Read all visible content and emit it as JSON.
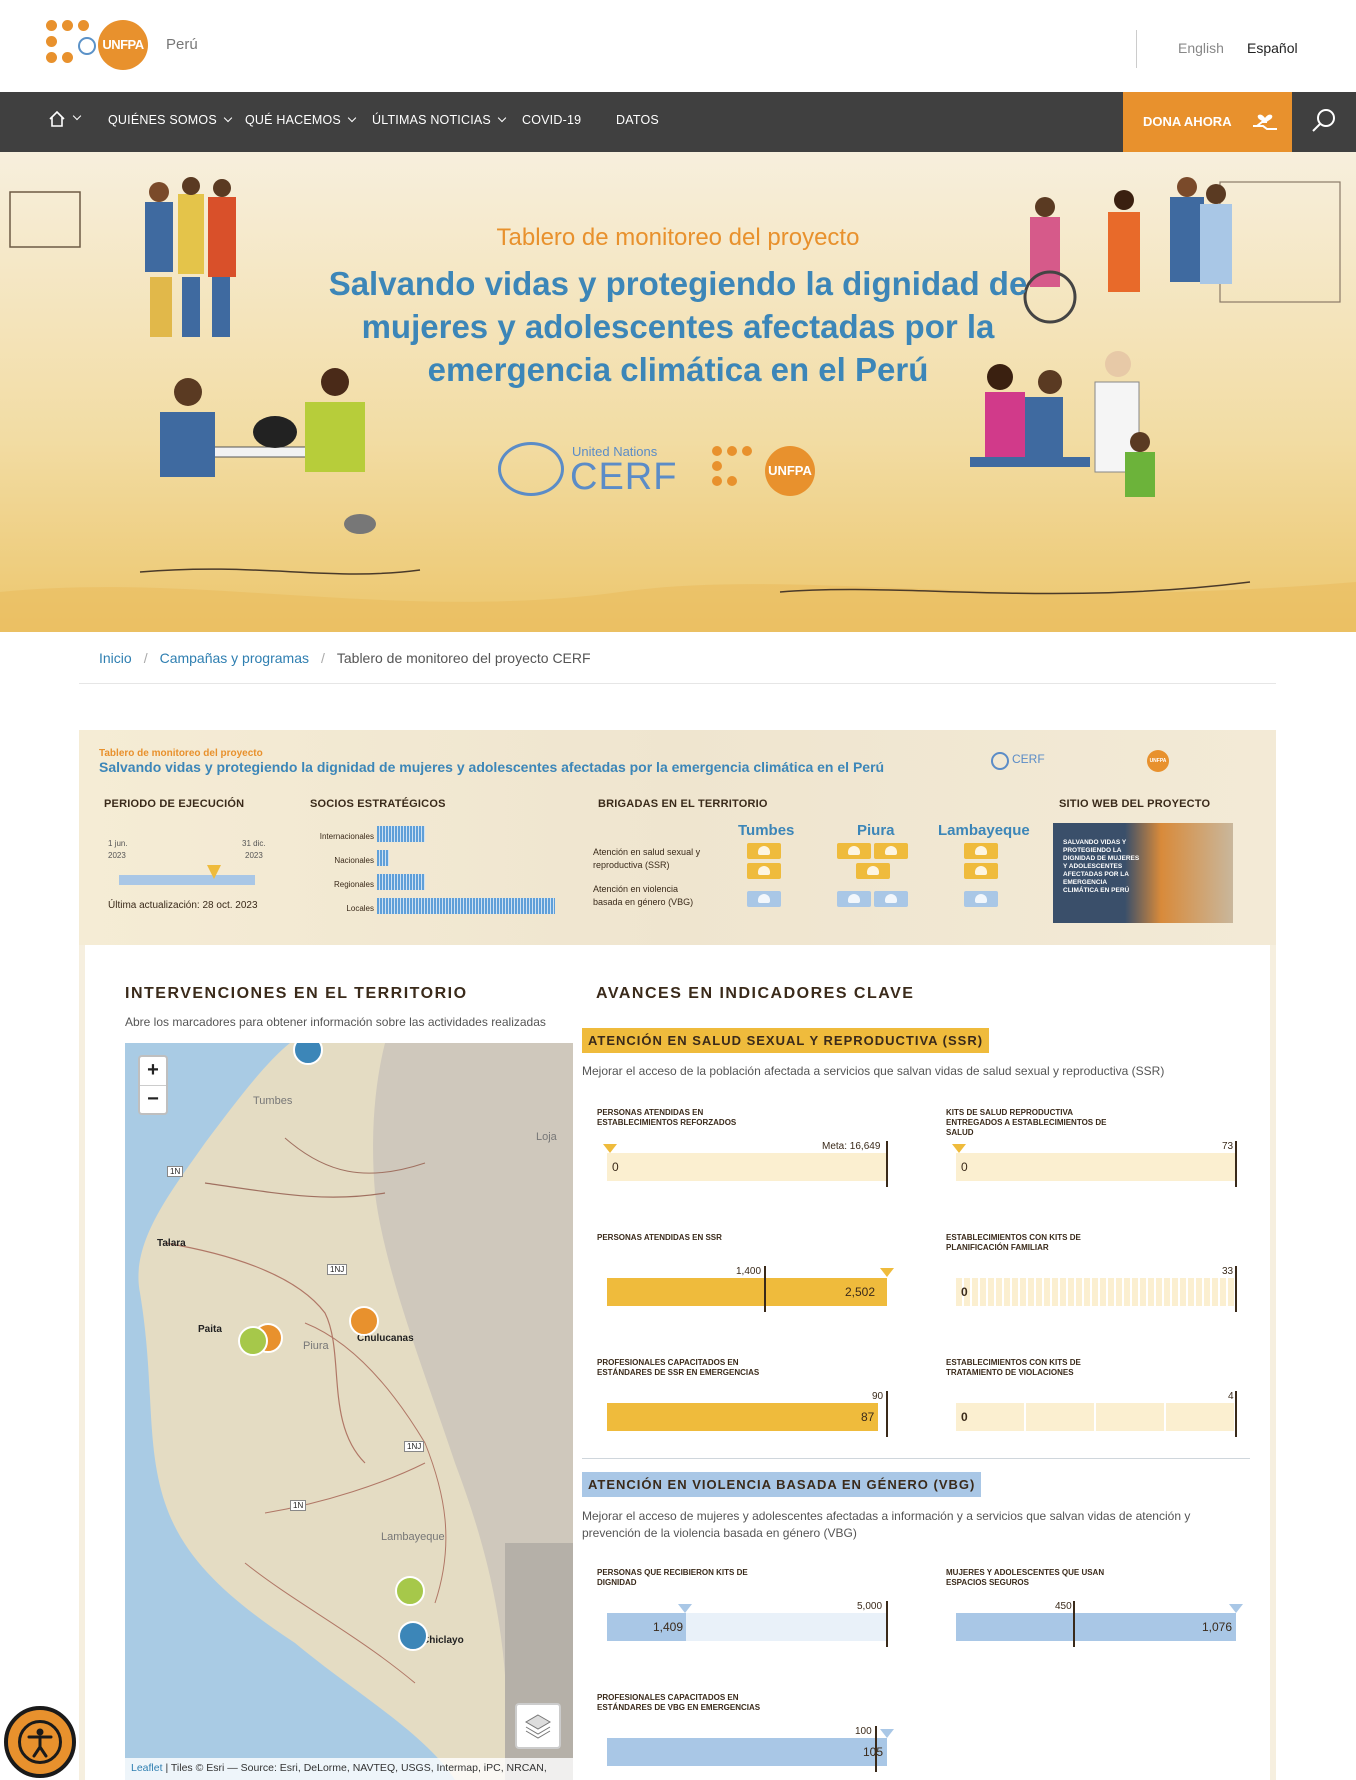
{
  "header": {
    "logo_text": "UNFPA",
    "country": "Perú",
    "languages": [
      "English",
      "Español"
    ]
  },
  "nav": {
    "items": [
      "QUIÉNES SOMOS",
      "QUÉ HACEMOS",
      "ÚLTIMAS NOTICIAS",
      "COVID-19",
      "DATOS"
    ],
    "donate": "DONA AHORA"
  },
  "hero": {
    "subtitle": "Tablero de monitoreo del proyecto",
    "title": "Salvando vidas y protegiendo la dignidad de mujeres y adolescentes afectadas por la emergencia climática en el Perú",
    "cerf_small": "United Nations",
    "cerf_big": "CERF",
    "unfpa": "UNFPA"
  },
  "breadcrumb": {
    "home": "Inicio",
    "parent": "Campañas y programas",
    "current": "Tablero de monitoreo del proyecto CERF"
  },
  "dashboard": {
    "subtitle": "Tablero de monitoreo del proyecto",
    "title": "Salvando vidas y protegiendo la dignidad de mujeres y adolescentes afectadas por la emergencia climática en el Perú",
    "periodo": {
      "heading": "PERIODO DE EJECUCIÓN",
      "start": "1 jun.",
      "start_year": "2023",
      "end": "31 dic.",
      "end_year": "2023",
      "updated": "Última actualización: 28 oct. 2023",
      "progress": 0.6
    },
    "socios": {
      "heading": "SOCIOS ESTRATÉGICOS",
      "rows": [
        {
          "label": "Internacionales",
          "count": 12
        },
        {
          "label": "Nacionales",
          "count": 3
        },
        {
          "label": "Regionales",
          "count": 12
        },
        {
          "label": "Locales",
          "count": 46
        }
      ]
    },
    "brigadas": {
      "heading": "BRIGADAS EN EL TERRITORIO",
      "cities": [
        "Tumbes",
        "Piura",
        "Lambayeque"
      ],
      "row_ssr": "Atención en salud sexual y reproductiva (SSR)",
      "row_vbg": "Atención en violencia basada en género (VBG)"
    },
    "sitio": {
      "heading": "SITIO WEB DEL PROYECTO",
      "thumb_text": "SALVANDO VIDAS Y PROTEGIENDO LA DIGNIDAD DE MUJERES Y ADOLESCENTES AFECTADAS POR LA EMERGENCIA CLIMÁTICA EN PERÚ"
    }
  },
  "interventions": {
    "heading": "INTERVENCIONES EN EL TERRITORIO",
    "desc": "Abre los marcadores para obtener información sobre las actividades realizadas",
    "places": [
      "Tumbes",
      "Loja",
      "Talara",
      "Paita",
      "Piura",
      "Chulucanas",
      "Lambayeque",
      "Chiclayo"
    ],
    "roads": [
      "1N",
      "1NJ",
      "1NJ",
      "1N"
    ],
    "attribution_link": "Leaflet",
    "attribution": " | Tiles © Esri — Source: Esri, DeLorme, NAVTEQ, USGS, Intermap, iPC, NRCAN,"
  },
  "indicators": {
    "heading": "AVANCES EN INDICADORES CLAVE",
    "ssr": {
      "badge": "ATENCIÓN EN SALUD SEXUAL Y REPRODUCTIVA (SSR)",
      "desc": "Mejorar el acceso de la población afectada a servicios que salvan vidas de salud sexual y reproductiva (SSR)",
      "items": [
        {
          "label": "PERSONAS ATENDIDAS EN ESTABLECIMIENTOS REFORZADOS",
          "value": "0",
          "target": "Meta:  16,649"
        },
        {
          "label": "KITS DE SALUD REPRODUCTIVA ENTREGADOS A ESTABLECIMIENTOS DE SALUD",
          "value": "0",
          "target": "73"
        },
        {
          "label": "PERSONAS ATENDIDAS EN SSR",
          "value": "2,502",
          "target": "1,400"
        },
        {
          "label": "ESTABLECIMIENTOS CON KITS DE PLANIFICACIÓN FAMILIAR",
          "value": "0",
          "target": "33"
        },
        {
          "label": "PROFESIONALES CAPACITADOS EN ESTÁNDARES DE SSR EN EMERGENCIAS",
          "value": "87",
          "target": "90"
        },
        {
          "label": "ESTABLECIMIENTOS CON KITS DE TRATAMIENTO DE VIOLACIONES",
          "value": "0",
          "target": "4"
        }
      ]
    },
    "vbg": {
      "badge": "ATENCIÓN EN VIOLENCIA BASADA EN GÉNERO (VBG)",
      "desc": "Mejorar el acceso de mujeres y adolescentes afectadas a información y a servicios que salvan vidas de atención y prevención de la violencia basada en género (VBG)",
      "items": [
        {
          "label": "PERSONAS QUE RECIBIERON KITS DE DIGNIDAD",
          "value": "1,409",
          "target": "5,000"
        },
        {
          "label": "MUJERES Y ADOLESCENTES QUE USAN ESPACIOS SEGUROS",
          "value": "1,076",
          "target": "450"
        },
        {
          "label": "PROFESIONALES CAPACITADOS EN ESTÁNDARES DE VBG EN EMERGENCIAS",
          "value": "105",
          "target": "100"
        }
      ]
    }
  },
  "colors": {
    "accent": "#e8912d",
    "nav": "#404040",
    "blue": "#3c86b8",
    "ssr_fill": "#efbb3c",
    "ssr_track": "#fbefd0",
    "vbg_fill": "#a9c7e6",
    "vbg_track": "#e9f1f9"
  }
}
